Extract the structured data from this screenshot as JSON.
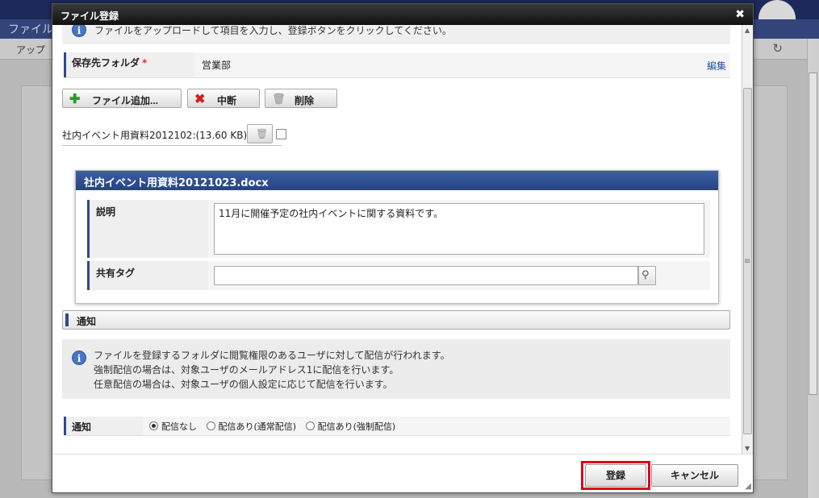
{
  "background": {
    "title_fragment": "ファイル",
    "toolbar_item": "アップ"
  },
  "dialog": {
    "title": "ファイル登録",
    "close_glyph": "✖",
    "info_top": "ファイルをアップロードして項目を入力し、登録ボタンをクリックしてください。",
    "folder": {
      "label": "保存先フォルダ",
      "required_mark": "*",
      "value": "営業部",
      "edit_label": "編集"
    },
    "actions": {
      "add_file": "ファイル追加...",
      "cancel_upload": "中断",
      "delete": "削除"
    },
    "file_entry": {
      "name": "社内イベント用資料2012102:(13.60 KB)"
    },
    "file_box": {
      "title": "社内イベント用資料20121023.docx",
      "description_label": "説明",
      "description_value": "11月に開催予定の社内イベントに関する資料です。",
      "tags_label": "共有タグ",
      "tags_value": ""
    },
    "notice": {
      "title": "通知",
      "info_lines": [
        "ファイルを登録するフォルダに閲覧権限のあるユーザに対して配信が行われます。",
        "強制配信の場合は、対象ユーザのメールアドレス1に配信を行います。",
        "任意配信の場合は、対象ユーザの個人設定に応じて配信を行います。"
      ],
      "row_label": "通知",
      "options": [
        "配信なし",
        "配信あり(通常配信)",
        "配信あり(強制配信)"
      ],
      "selected_index": 0
    },
    "footer": {
      "register": "登録",
      "cancel": "キャンセル"
    }
  },
  "colors": {
    "accent": "#2b4a8e",
    "highlight": "#e0001a",
    "link": "#2653a6"
  }
}
